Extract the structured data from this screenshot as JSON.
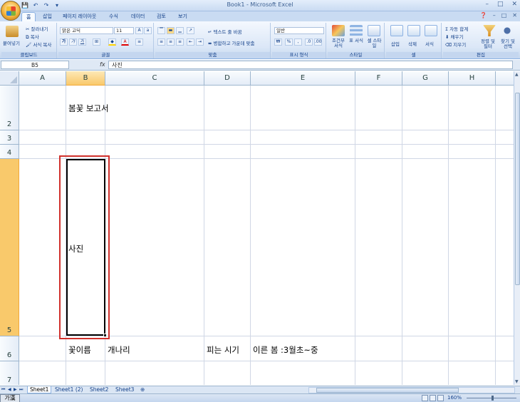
{
  "window": {
    "title": "Book1 - Microsoft Excel",
    "minimize": "–",
    "maximize": "□",
    "close": "✕"
  },
  "qat": [
    "💾",
    "↶",
    "↷",
    "▾"
  ],
  "tabs": [
    "홈",
    "삽입",
    "페이지 레이아웃",
    "수식",
    "데이터",
    "검토",
    "보기"
  ],
  "active_tab": "홈",
  "ribbon": {
    "clipboard": {
      "label": "클립보드",
      "paste": "붙여넣기",
      "cut": "잘라내기",
      "copy": "복사",
      "format_painter": "서식 복사"
    },
    "font": {
      "label": "글꼴",
      "font_name": "맑은 고딕",
      "font_size": "11",
      "bold": "가",
      "italic": "가",
      "underline": "가"
    },
    "alignment": {
      "label": "맞춤",
      "wrap_text": "텍스트 줄 바꿈",
      "merge": "병합하고 가운데 맞춤"
    },
    "number": {
      "label": "표시 형식",
      "format": "일반",
      "percent": "%",
      "comma": ","
    },
    "styles": {
      "label": "스타일",
      "conditional": "조건부 서식",
      "table": "표 서식",
      "cell_styles": "셀 스타일"
    },
    "cells": {
      "label": "셀",
      "insert": "삽입",
      "delete": "삭제",
      "format": "서식"
    },
    "editing": {
      "label": "편집",
      "autosum": "자동 합계",
      "fill": "채우기",
      "clear": "지우기",
      "sort": "정렬 및 필터",
      "find": "찾기 및 선택"
    }
  },
  "formula_bar": {
    "name_box": "B5",
    "fx": "fx",
    "value": "사진"
  },
  "columns": [
    "A",
    "B",
    "C",
    "D",
    "E",
    "F",
    "G",
    "H"
  ],
  "selected_column": "B",
  "rows": [
    "2",
    "3",
    "4",
    "5",
    "6",
    "7"
  ],
  "selected_row": "5",
  "cells": {
    "B2": "봄꽃 보고서",
    "B5": "사진",
    "B6": "꽃이름",
    "C6": "개나리",
    "D6": "피는 시기",
    "E6": "이른 봄 :3월초~중"
  },
  "sheets": [
    "Sheet1",
    "Sheet1 (2)",
    "Sheet2",
    "Sheet3"
  ],
  "active_sheet": "Sheet1",
  "status": {
    "ime": "가漢",
    "zoom": "160%"
  },
  "colors": {
    "selection_border": "#d0312d",
    "header_selected": "#f9c96b",
    "ribbon_bg": "#dbe7f7"
  }
}
